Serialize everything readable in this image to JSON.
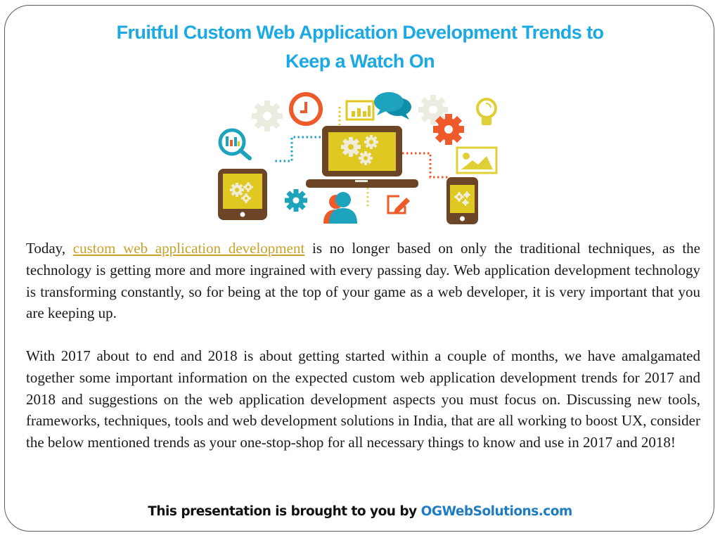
{
  "slide": {
    "title_line1": "Fruitful Custom Web Application Development Trends to",
    "title_line2": "Keep a Watch On",
    "illustration": {
      "icons": [
        "laptop-icon",
        "tablet-icon",
        "smartphone-icon",
        "magnifier-chart-icon",
        "clock-icon",
        "bar-chart-icon",
        "speech-bubbles-icon",
        "gear-icon",
        "lightbulb-icon",
        "image-icon",
        "users-icon",
        "edit-icon"
      ],
      "colors": {
        "brown": "#6b4526",
        "yellow": "#e0c823",
        "teal": "#1ea3bd",
        "orange": "#ee5a2a",
        "beige": "#ecebe0",
        "light_yellow": "#e8d545"
      }
    },
    "paragraph1": {
      "prefix": "Today, ",
      "link_text": "custom web application development",
      "suffix": " is no longer based on only the traditional techniques, as the technology is getting more and more ingrained with every passing day. Web application development technology is transforming constantly, so for being at the top of  your game as a web developer, it is very important that you are keeping up."
    },
    "paragraph2": "With 2017 about to end and 2018 is about getting started within a couple of  months, we have amalgamated together some important information on the expected custom web application development trends for 2017 and 2018 and suggestions on the web application development aspects you must focus on. Discussing new tools, frameworks, techniques, tools and web development solutions in India,  that are all working to boost UX, consider the below mentioned trends as your one-stop-shop for all necessary things  to know and use in 2017 and 2018!",
    "footer": {
      "prefix": "This presentation is brought to you by ",
      "brand": "OGWebSolutions.com"
    },
    "colors": {
      "title": "#1aa9e3",
      "link": "#c9a22a",
      "brand": "#1f7cc2",
      "text": "#1a1a1a"
    }
  }
}
